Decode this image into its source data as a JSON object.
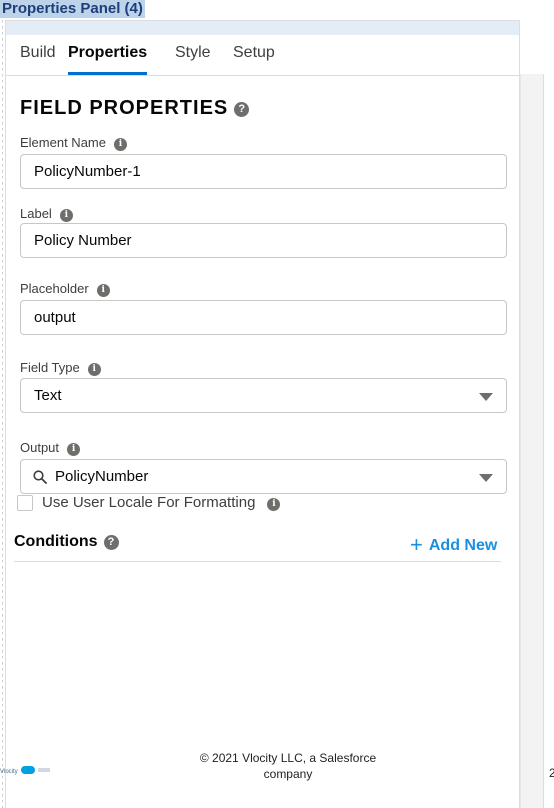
{
  "document": {
    "title": "Properties Panel (4)",
    "page_number": "2",
    "copyright": "© 2021 Vlocity LLC, a Salesforce company",
    "footer_logo_text": "Vlocity"
  },
  "tabs": [
    {
      "label": "Build",
      "active": false
    },
    {
      "label": "Properties",
      "active": true
    },
    {
      "label": "Style",
      "active": false
    },
    {
      "label": "Setup",
      "active": false
    }
  ],
  "section": {
    "title": "FIELD PROPERTIES"
  },
  "fields": {
    "element_name": {
      "label": "Element Name",
      "value": "PolicyNumber-1"
    },
    "label": {
      "label": "Label",
      "value": "Policy Number"
    },
    "placeholder": {
      "label": "Placeholder",
      "value": "output"
    },
    "field_type": {
      "label": "Field Type",
      "value": "Text"
    },
    "output": {
      "label": "Output",
      "value": "PolicyNumber"
    }
  },
  "use_user_locale": {
    "label": "Use User Locale For Formatting",
    "checked": false
  },
  "conditions": {
    "title": "Conditions",
    "add_new_label": "Add New"
  },
  "colors": {
    "accent": "#0070d2",
    "link": "#1b8fe0",
    "border": "#c9c7c5"
  }
}
